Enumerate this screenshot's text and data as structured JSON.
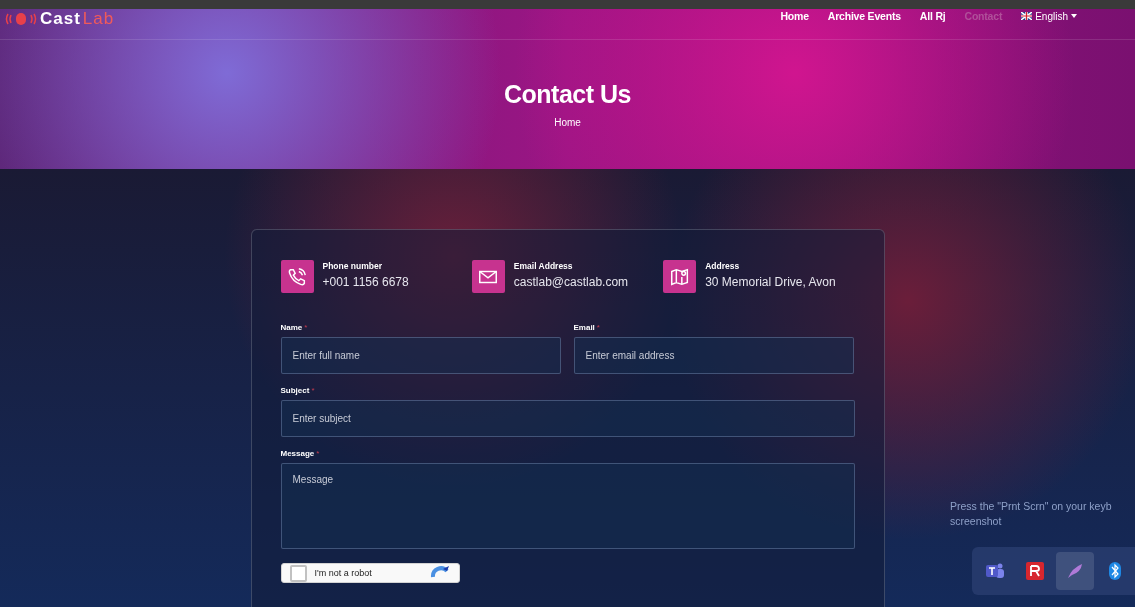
{
  "logo": {
    "part1": "Cast",
    "part2": "Lab"
  },
  "nav": [
    {
      "label": "Home",
      "selected": false
    },
    {
      "label": "Archive Events",
      "selected": false
    },
    {
      "label": "All Rj",
      "selected": false
    },
    {
      "label": "Contact",
      "selected": true
    }
  ],
  "language": {
    "label": "English"
  },
  "hero": {
    "title": "Contact Us",
    "breadcrumb": "Home"
  },
  "contacts": [
    {
      "kind": "phone",
      "title": "Phone number",
      "value": "+001 1156 6678"
    },
    {
      "kind": "email",
      "title": "Email Address",
      "value": "castlab@castlab.com"
    },
    {
      "kind": "address",
      "title": "Address",
      "value": "30 Memorial Drive, Avon"
    }
  ],
  "form": {
    "required_mark": "*",
    "fields": [
      {
        "kind": "input",
        "label": "Name",
        "placeholder": "Enter full name",
        "required": true,
        "wide": false
      },
      {
        "kind": "input",
        "label": "Email",
        "placeholder": "Enter email address",
        "required": true,
        "wide": false
      },
      {
        "kind": "input",
        "label": "Subject",
        "placeholder": "Enter subject",
        "required": true,
        "wide": true
      },
      {
        "kind": "textarea",
        "label": "Message",
        "placeholder": "Message",
        "required": true,
        "wide": true
      }
    ],
    "captcha": {
      "label": "I'm not a robot",
      "checked": false
    }
  },
  "tray": {
    "tip_line1": "Press the \"Prnt Scrn\" on your keyb",
    "tip_line2": "screenshot",
    "icons": [
      {
        "kind": "teams",
        "selected": false
      },
      {
        "kind": "red-app",
        "selected": false
      },
      {
        "kind": "feather",
        "selected": true
      },
      {
        "kind": "bluetooth",
        "selected": false
      }
    ]
  }
}
